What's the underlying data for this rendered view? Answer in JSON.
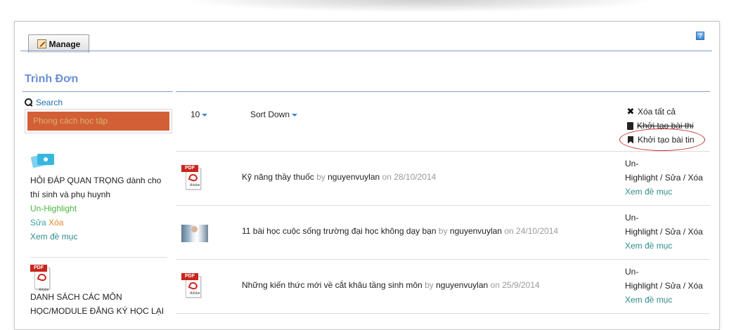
{
  "toolbar": {
    "manage_label": "Manage",
    "help_label": "?"
  },
  "menu": {
    "title": "Trình Đơn",
    "search_label": "Search",
    "style_label": "Phong cách học tập"
  },
  "sidebar": {
    "items": [
      {
        "title": "HỎI ĐÁP QUAN TRỌNG dành cho thí sinh và phụ huynh",
        "unhighlight": "Un-Highlight",
        "edit": "Sửa",
        "delete": "Xóa",
        "view": "Xem đề mục"
      },
      {
        "title": "DANH SÁCH CÁC MÔN HỌC/MODULE ĐĂNG KÝ HỌC LẠI"
      }
    ]
  },
  "list": {
    "per_page": "10",
    "sort_label": "Sort Down",
    "actions": {
      "delete_all": "Xóa tất cả",
      "create_exam": "Khởi tạo bài thi",
      "create_news": "Khởi tạo bài tin"
    },
    "ops": {
      "un": "Un-",
      "highlight": "Highlight",
      "sep": " / ",
      "edit": "Sửa",
      "delete": "Xóa",
      "view": "Xem đề mục"
    },
    "rows": [
      {
        "title": "Kỹ năng thầy thuốc",
        "by": "by",
        "author": "nguyenvuylan",
        "on": "on",
        "date": "28/10/2014"
      },
      {
        "title": "11 bài học cuộc sống trường đại học không dạy bạn",
        "by": "by",
        "author": "nguyenvuylan",
        "on": "on",
        "date": "24/10/2014"
      },
      {
        "title": "Những kiến thức mới về cắt khâu tầng sinh môn",
        "by": "by",
        "author": "nguyenvuylan",
        "on": "on",
        "date": "25/9/2014"
      }
    ]
  },
  "colors": {
    "accent": "#6b8fd6",
    "link": "#2e8b8b",
    "style_box": "#d35f36",
    "oval": "#c43131"
  }
}
